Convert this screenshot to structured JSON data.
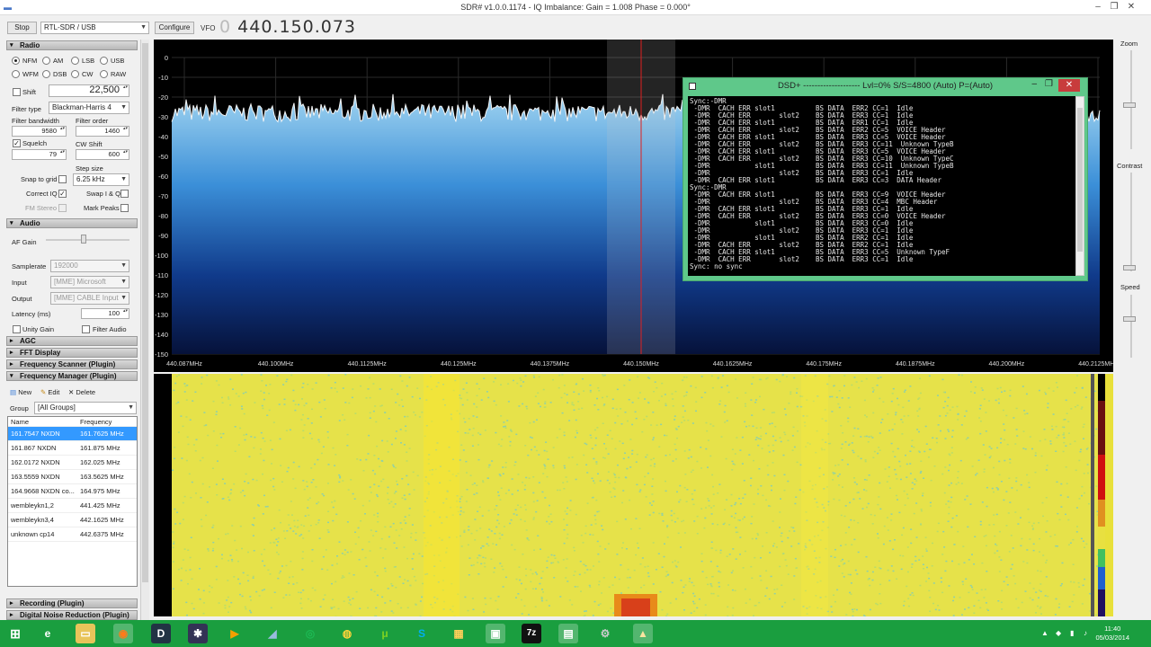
{
  "window": {
    "title": "SDR# v1.0.0.1174 - IQ Imbalance: Gain = 1.008 Phase = 0.000°",
    "minimize": "–",
    "restore": "❐",
    "close": "✕"
  },
  "toolbar": {
    "stop_label": "Stop",
    "device": "RTL-SDR / USB",
    "configure_label": "Configure",
    "vfo_label": "VFO",
    "vfo_leading": "0",
    "vfo_value": "440.150.073"
  },
  "radio": {
    "header": "Radio",
    "modes": [
      {
        "label": "NFM",
        "selected": true
      },
      {
        "label": "AM",
        "selected": false
      },
      {
        "label": "LSB",
        "selected": false
      },
      {
        "label": "USB",
        "selected": false
      },
      {
        "label": "WFM",
        "selected": false
      },
      {
        "label": "DSB",
        "selected": false
      },
      {
        "label": "CW",
        "selected": false
      },
      {
        "label": "RAW",
        "selected": false
      }
    ],
    "shift_label": "Shift",
    "shift_value": "22,500",
    "filter_type_label": "Filter type",
    "filter_type_value": "Blackman-Harris 4",
    "filter_bandwidth_label": "Filter bandwidth",
    "filter_bandwidth_value": "9580",
    "filter_order_label": "Filter order",
    "filter_order_value": "1460",
    "squelch_label": "Squelch",
    "squelch_value": "79",
    "cw_shift_label": "CW Shift",
    "cw_shift_value": "600",
    "step_size_label": "Step size",
    "snap_label": "Snap to grid",
    "step_value": "6.25 kHz",
    "correct_iq_label": "Correct IQ",
    "swap_iq_label": "Swap I & Q",
    "fm_stereo_label": "FM Stereo",
    "mark_peaks_label": "Mark Peaks"
  },
  "audio": {
    "header": "Audio",
    "af_gain_label": "AF Gain",
    "af_gain_level": 0.45,
    "samplerate_label": "Samplerate",
    "samplerate_value": "192000",
    "input_label": "Input",
    "input_value": "[MME] Microsoft Sound",
    "output_label": "Output",
    "output_value": "[MME] CABLE Input (V(",
    "latency_label": "Latency (ms)",
    "latency_value": "100",
    "unity_gain_label": "Unity Gain",
    "filter_audio_label": "Filter Audio"
  },
  "sections": {
    "agc": "AGC",
    "fft": "FFT Display",
    "scanner": "Frequency Scanner (Plugin)",
    "manager": "Frequency Manager (Plugin)",
    "recording": "Recording (Plugin)",
    "noise": "Digital Noise Reduction (Plugin)"
  },
  "freq_manager": {
    "new_label": "New",
    "edit_label": "Edit",
    "delete_label": "Delete",
    "group_label": "Group",
    "group_value": "[All Groups]",
    "col_name": "Name",
    "col_frequency": "Frequency",
    "rows": [
      {
        "name": "161.7547 NXDN",
        "freq": "161.7625 MHz"
      },
      {
        "name": "161.867 NXDN",
        "freq": "161.875 MHz"
      },
      {
        "name": "162.0172 NXDN",
        "freq": "162.025 MHz"
      },
      {
        "name": "163.5559 NXDN",
        "freq": "163.5625 MHz"
      },
      {
        "name": "164.9668 NXDN co...",
        "freq": "164.975 MHz"
      },
      {
        "name": "wembleykn1,2",
        "freq": "441.425 MHz"
      },
      {
        "name": "wembleykn3,4",
        "freq": "442.1625 MHz"
      },
      {
        "name": "unknown cp14",
        "freq": "442.6375 MHz"
      }
    ]
  },
  "spectrum": {
    "db_ticks": [
      "0",
      "-10",
      "-20",
      "-30",
      "-40",
      "-50",
      "-60",
      "-70",
      "-80",
      "-90",
      "-100",
      "-110",
      "-120",
      "-130",
      "-140",
      "-150"
    ],
    "freq_ticks": [
      "440.087MHz",
      "440.100MHz",
      "440.1125MHz",
      "440.125MHz",
      "440.1375MHz",
      "440.150MHz",
      "440.1625MHz",
      "440.175MHz",
      "440.1875MHz",
      "440.200MHz",
      "440.2125MHz"
    ],
    "noise_floor_db": -28
  },
  "right_panel": {
    "zoom_label": "Zoom",
    "contrast_label": "Contrast",
    "speed_label": "Speed"
  },
  "dsd": {
    "title": "DSD+   --------------------  Lvl=0%  S/S=4800 (Auto) P=(Auto)",
    "lines": [
      "Sync:-DMR",
      " -DMR  CACH ERR slot1          BS DATA  ERR2 CC=1  Idle",
      " -DMR  CACH ERR       slot2    BS DATA  ERR3 CC=1  Idle",
      " -DMR  CACH ERR slot1          BS DATA  ERR1 CC=1  Idle",
      " -DMR  CACH ERR       slot2    BS DATA  ERR2 CC=5  VOICE Header",
      " -DMR  CACH ERR slot1          BS DATA  ERR3 CC=5  VOICE Header",
      " -DMR  CACH ERR       slot2    BS DATA  ERR3 CC=11  Unknown TypeB",
      " -DMR  CACH ERR slot1          BS DATA  ERR3 CC=5  VOICE Header",
      " -DMR  CACH ERR       slot2    BS DATA  ERR3 CC=10  Unknown TypeC",
      " -DMR           slot1          BS DATA  ERR3 CC=11  Unknown TypeB",
      " -DMR                 slot2    BS DATA  ERR3 CC=1  Idle",
      " -DMR  CACH ERR slot1          BS DATA  ERR3 CC=3  DATA Header",
      "Sync:-DMR",
      " -DMR  CACH ERR slot1          BS DATA  ERR3 CC=9  VOICE Header",
      " -DMR                 slot2    BS DATA  ERR3 CC=4  MBC Header",
      " -DMR  CACH ERR slot1          BS DATA  ERR3 CC=1  Idle",
      " -DMR  CACH ERR       slot2    BS DATA  ERR3 CC=0  VOICE Header",
      " -DMR           slot1          BS DATA  ERR3 CC=0  Idle",
      " -DMR                 slot2    BS DATA  ERR3 CC=1  Idle",
      " -DMR           slot1          BS DATA  ERR2 CC=1  Idle",
      " -DMR  CACH ERR       slot2    BS DATA  ERR2 CC=1  Idle",
      " -DMR  CACH ERR slot1          BS DATA  ERR3 CC=5  Unknown TypeF",
      " -DMR  CACH ERR       slot2    BS DATA  ERR3 CC=1  Idle",
      "Sync: no sync"
    ]
  },
  "taskbar": {
    "time": "11:40",
    "date": "05/03/2014"
  }
}
